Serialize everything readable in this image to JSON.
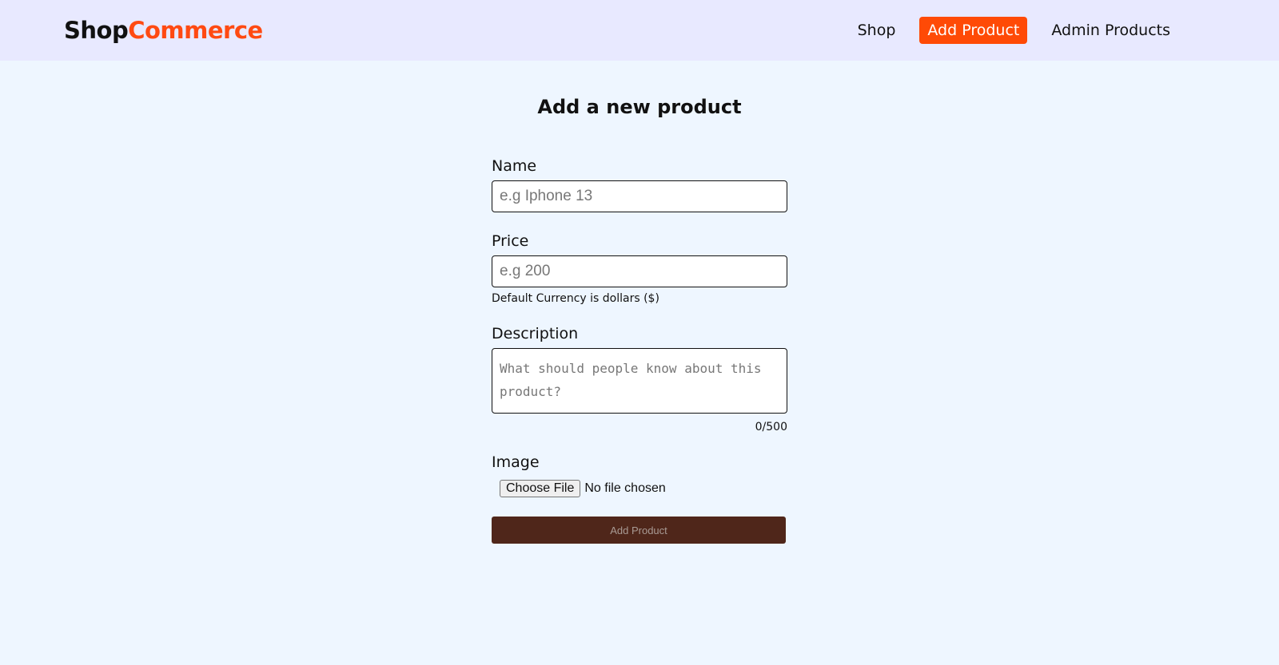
{
  "brand": {
    "part1": "Shop",
    "part2": "Commerce"
  },
  "nav": {
    "items": [
      {
        "label": "Shop"
      },
      {
        "label": "Add Product"
      },
      {
        "label": "Admin Products"
      }
    ],
    "active_item": "Add Product"
  },
  "colors": {
    "accent": "#ff4a06",
    "navbar_bg": "#e8e9ff",
    "page_bg": "#eef6ff",
    "submit_bg": "#4f261a"
  },
  "page": {
    "title": "Add a new product"
  },
  "form": {
    "name": {
      "label": "Name",
      "placeholder": "e.g Iphone 13",
      "value": ""
    },
    "price": {
      "label": "Price",
      "placeholder": "e.g 200",
      "value": "",
      "hint": "Default Currency is dollars ($)"
    },
    "description": {
      "label": "Description",
      "placeholder": "What should people know about this product?",
      "value": "",
      "counter": "0/500"
    },
    "image": {
      "label": "Image",
      "button_label": "Choose File",
      "status": "No file chosen"
    },
    "submit_label": "Add Product"
  }
}
